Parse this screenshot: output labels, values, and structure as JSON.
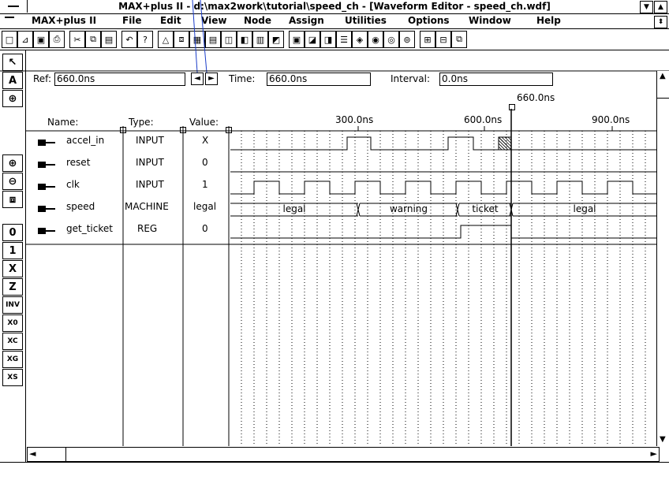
{
  "window": {
    "title": "MAX+plus II - d:\\max2work\\tutorial\\speed_ch - [Waveform Editor - speed_ch.wdf]"
  },
  "menu": [
    {
      "label": "MAX+plus II"
    },
    {
      "label": "File"
    },
    {
      "label": "Edit"
    },
    {
      "label": "View"
    },
    {
      "label": "Node"
    },
    {
      "label": "Assign"
    },
    {
      "label": "Utilities"
    },
    {
      "label": "Options"
    },
    {
      "label": "Window"
    },
    {
      "label": "Help"
    }
  ],
  "ref": {
    "label": "Ref:",
    "value": "660.0ns"
  },
  "time": {
    "label": "Time:",
    "value": "660.0ns"
  },
  "interval": {
    "label": "Interval:",
    "value": "0.0ns"
  },
  "cursor_label": "660.0ns",
  "columns": {
    "name": "Name:",
    "type": "Type:",
    "value": "Value:"
  },
  "timeline": {
    "ticks": [
      "300.0ns",
      "600.0ns",
      "900.0ns"
    ]
  },
  "signals": [
    {
      "name": "accel_in",
      "type": "INPUT",
      "value": "X",
      "icon": "input-pin-icon"
    },
    {
      "name": "reset",
      "type": "INPUT",
      "value": "0",
      "icon": "input-pin-icon"
    },
    {
      "name": "clk",
      "type": "INPUT",
      "value": "1",
      "icon": "input-pin-icon"
    },
    {
      "name": "speed",
      "type": "MACHINE",
      "value": "legal",
      "icon": "machine-icon"
    },
    {
      "name": "get_ticket",
      "type": "REG",
      "value": "0",
      "icon": "register-icon"
    }
  ],
  "speed_states": [
    "legal",
    "warning",
    "ticket",
    "legal"
  ],
  "left_tools": [
    "pointer-icon",
    "text-tool-icon",
    "node-select-icon",
    "zoom-in-icon",
    "zoom-out-icon",
    "fit-window-icon",
    "set-0-icon",
    "set-1-icon",
    "set-x-icon",
    "set-z-icon",
    "invert-icon",
    "overwrite-icon",
    "clock-icon",
    "group-icon",
    "state-icon"
  ],
  "toolbar_icons": [
    "new-icon",
    "open-icon",
    "save-icon",
    "print-icon",
    "cut-icon",
    "copy-icon",
    "paste-icon",
    "undo-icon",
    "help-icon",
    "hierarchy-icon",
    "floorplan-icon",
    "symbol-icon",
    "waveform-icon",
    "compiler-icon",
    "simulator-icon",
    "timing-icon",
    "programmer-icon",
    "project-icon",
    "save-check-icon",
    "compile-icon",
    "simulate-icon",
    "analyze-icon",
    "find-icon",
    "find-next-icon",
    "find-prev-icon",
    "grid-icon",
    "zoom-icon",
    "overlay-icon"
  ],
  "colors": {
    "background": "#ffffff",
    "lines": "#000000",
    "accent": "#1a3cc8"
  }
}
